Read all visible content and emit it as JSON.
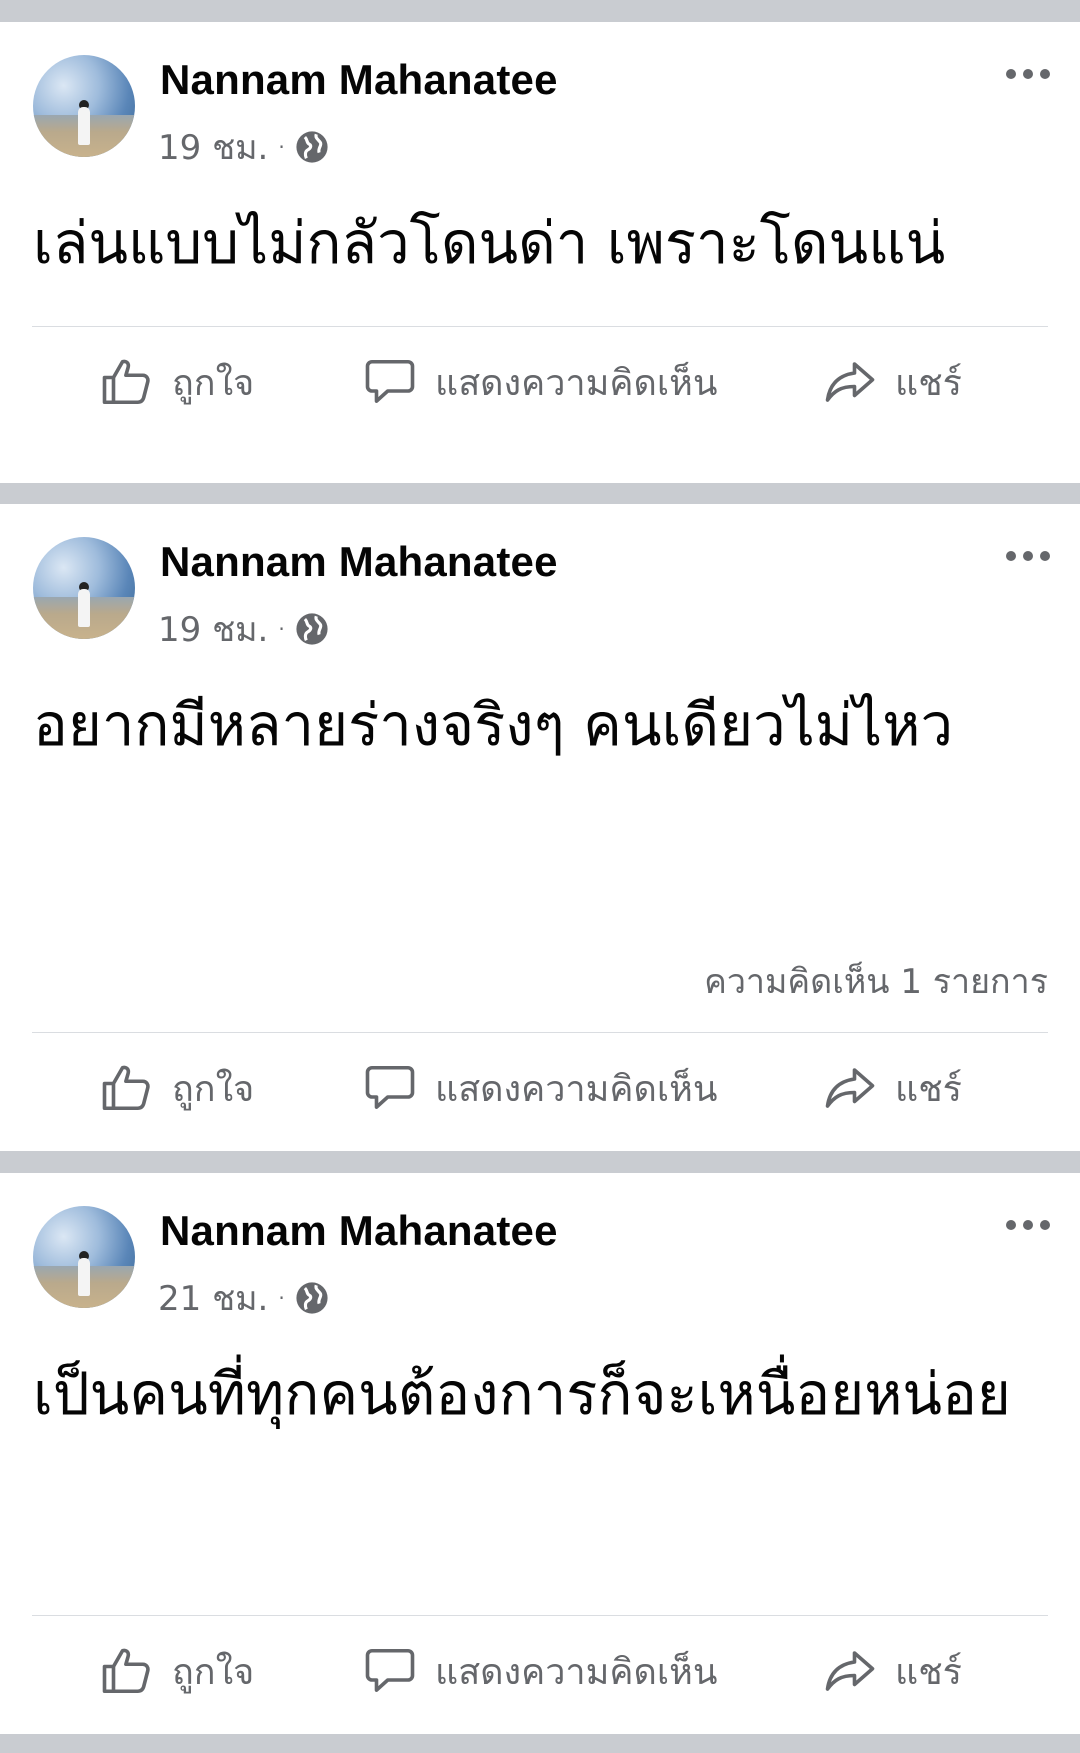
{
  "posts": [
    {
      "author": "Nannam Mahanatee",
      "time": "19 ชม.",
      "separator": "·",
      "privacy_icon": "globe-icon",
      "text": "เล่นแบบไม่กลัวโดนด่า เพราะโดนแน่",
      "comment_count": "",
      "actions": {
        "like": "ถูกใจ",
        "comment": "แสดงความคิดเห็น",
        "share": "แชร์"
      }
    },
    {
      "author": "Nannam Mahanatee",
      "time": "19 ชม.",
      "separator": "·",
      "privacy_icon": "globe-icon",
      "text": "อยากมีหลายร่างจริงๆ คนเดียวไม่ไหว",
      "comment_count": "ความคิดเห็น 1 รายการ",
      "actions": {
        "like": "ถูกใจ",
        "comment": "แสดงความคิดเห็น",
        "share": "แชร์"
      }
    },
    {
      "author": "Nannam Mahanatee",
      "time": "21 ชม.",
      "separator": "·",
      "privacy_icon": "globe-icon",
      "text": "เป็นคนที่ทุกคนต้องการก็จะเหนื่อยหน่อย",
      "comment_count": "",
      "actions": {
        "like": "ถูกใจ",
        "comment": "แสดงความคิดเห็น",
        "share": "แชร์"
      }
    }
  ],
  "colors": {
    "feed_background": "#c9ccd1",
    "card_background": "#ffffff",
    "secondary_text": "#65676b",
    "divider": "#dadde1"
  }
}
